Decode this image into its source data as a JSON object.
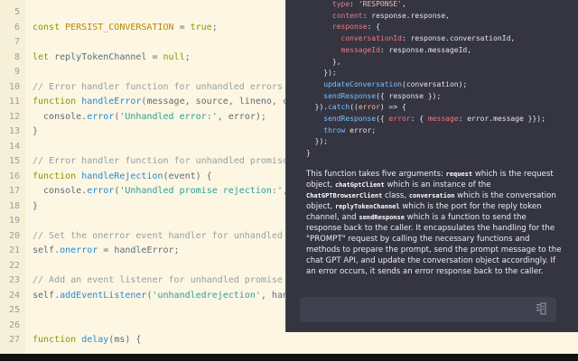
{
  "editor": {
    "lines": [
      {
        "num": "5",
        "tokens": []
      },
      {
        "num": "6",
        "tokens": [
          [
            "kw",
            "const "
          ],
          [
            "con",
            "PERSIST_CONVERSATION"
          ],
          [
            "",
            " = "
          ],
          [
            "kw",
            "true"
          ],
          [
            "",
            ";"
          ]
        ]
      },
      {
        "num": "7",
        "tokens": []
      },
      {
        "num": "8",
        "tokens": [
          [
            "kw",
            "let "
          ],
          [
            "",
            "replyTokenChannel = "
          ],
          [
            "kw",
            "null"
          ],
          [
            "",
            ";"
          ]
        ]
      },
      {
        "num": "9",
        "tokens": []
      },
      {
        "num": "10",
        "tokens": [
          [
            "cm",
            "// Error handler function for unhandled errors"
          ]
        ]
      },
      {
        "num": "11",
        "tokens": [
          [
            "kw",
            "function "
          ],
          [
            "fn",
            "handleError"
          ],
          [
            "",
            "(message, source, lineno, col"
          ]
        ]
      },
      {
        "num": "12",
        "tokens": [
          [
            "",
            "  console."
          ],
          [
            "fn",
            "error"
          ],
          [
            "",
            "("
          ],
          [
            "str",
            "'Unhandled error:'"
          ],
          [
            "",
            ", error);"
          ]
        ]
      },
      {
        "num": "13",
        "tokens": [
          [
            "",
            "}"
          ]
        ]
      },
      {
        "num": "14",
        "tokens": []
      },
      {
        "num": "15",
        "tokens": [
          [
            "cm",
            "// Error handler function for unhandled promise r"
          ]
        ]
      },
      {
        "num": "16",
        "tokens": [
          [
            "kw",
            "function "
          ],
          [
            "fn",
            "handleRejection"
          ],
          [
            "",
            "(event) {"
          ]
        ]
      },
      {
        "num": "17",
        "tokens": [
          [
            "",
            "  console."
          ],
          [
            "fn",
            "error"
          ],
          [
            "",
            "("
          ],
          [
            "str",
            "'Unhandled promise rejection:'"
          ],
          [
            "",
            ", e"
          ]
        ]
      },
      {
        "num": "18",
        "tokens": [
          [
            "",
            "}"
          ]
        ]
      },
      {
        "num": "19",
        "tokens": []
      },
      {
        "num": "20",
        "tokens": [
          [
            "cm",
            "// Set the onerror event handler for unhandled er"
          ]
        ]
      },
      {
        "num": "21",
        "tokens": [
          [
            "",
            "self."
          ],
          [
            "fn",
            "onerror"
          ],
          [
            "",
            " = handleError;"
          ]
        ]
      },
      {
        "num": "22",
        "tokens": []
      },
      {
        "num": "23",
        "tokens": [
          [
            "cm",
            "// Add an event listener for unhandled promise re"
          ]
        ]
      },
      {
        "num": "24",
        "tokens": [
          [
            "",
            "self."
          ],
          [
            "fn",
            "addEventListener"
          ],
          [
            "",
            "("
          ],
          [
            "str",
            "'unhandledrejection'"
          ],
          [
            "",
            ", handl"
          ]
        ]
      },
      {
        "num": "25",
        "tokens": []
      },
      {
        "num": "26",
        "tokens": []
      },
      {
        "num": "27",
        "tokens": [
          [
            "kw",
            "function "
          ],
          [
            "fn",
            "delay"
          ],
          [
            "",
            "(ms) {"
          ]
        ]
      }
    ]
  },
  "panel": {
    "code_lines": [
      {
        "indent": "      ",
        "tokens": [
          [
            "k",
            "type"
          ],
          [
            "",
            ": "
          ],
          [
            "v",
            "'RESPONSE'"
          ],
          [
            "",
            ","
          ]
        ]
      },
      {
        "indent": "      ",
        "tokens": [
          [
            "k",
            "content"
          ],
          [
            "",
            ": response.response,"
          ]
        ]
      },
      {
        "indent": "      ",
        "tokens": [
          [
            "k",
            "response"
          ],
          [
            "",
            ": {"
          ]
        ]
      },
      {
        "indent": "        ",
        "tokens": [
          [
            "k",
            "conversationId"
          ],
          [
            "",
            ": response.conversationId,"
          ]
        ]
      },
      {
        "indent": "        ",
        "tokens": [
          [
            "k",
            "messageId"
          ],
          [
            "",
            ": response.messageId,"
          ]
        ]
      },
      {
        "indent": "      ",
        "tokens": [
          [
            "",
            "},"
          ]
        ]
      },
      {
        "indent": "    ",
        "tokens": [
          [
            "",
            "});"
          ]
        ]
      },
      {
        "indent": "    ",
        "tokens": [
          [
            "f",
            "updateConversation"
          ],
          [
            "",
            "(conversation);"
          ]
        ]
      },
      {
        "indent": "    ",
        "tokens": [
          [
            "f",
            "sendResponse"
          ],
          [
            "",
            "({ response });"
          ]
        ]
      },
      {
        "indent": "  ",
        "tokens": [
          [
            "",
            "})."
          ],
          [
            "f",
            "catch"
          ],
          [
            "",
            "(("
          ],
          [
            "v",
            "error"
          ],
          [
            "",
            ") => {"
          ]
        ]
      },
      {
        "indent": "    ",
        "tokens": [
          [
            "f",
            "sendResponse"
          ],
          [
            "",
            "({ "
          ],
          [
            "k",
            "error"
          ],
          [
            "",
            ": { "
          ],
          [
            "k",
            "message"
          ],
          [
            "",
            ": error.message }});"
          ]
        ]
      },
      {
        "indent": "    ",
        "tokens": [
          [
            "f",
            "throw"
          ],
          [
            "",
            " error;"
          ]
        ]
      },
      {
        "indent": "  ",
        "tokens": [
          [
            "",
            "});"
          ]
        ]
      },
      {
        "indent": "",
        "tokens": [
          [
            "",
            "}"
          ]
        ]
      }
    ],
    "description": [
      {
        "t": "text",
        "v": "This function takes five arguments: "
      },
      {
        "t": "code",
        "v": "request"
      },
      {
        "t": "text",
        "v": " which is the request object, "
      },
      {
        "t": "code",
        "v": "chatGptClient"
      },
      {
        "t": "text",
        "v": " which is an instance of the "
      },
      {
        "t": "code",
        "v": "ChatGPTBrowserClient"
      },
      {
        "t": "text",
        "v": " class, "
      },
      {
        "t": "code",
        "v": "conversation"
      },
      {
        "t": "text",
        "v": " which is the conversation object, "
      },
      {
        "t": "code",
        "v": "replyTokenChannel"
      },
      {
        "t": "text",
        "v": " which is the port for the reply token channel, and "
      },
      {
        "t": "code",
        "v": "sendResponse"
      },
      {
        "t": "text",
        "v": " which is a function to send the response back to the caller. It encapsulates the handling for the \"PROMPT\" request by calling the necessary functions and methods to prepare the prompt, send the prompt message to the chat GPT API, and update the conversation object accordingly. If an error occurs, it sends an error response back to the caller."
      }
    ],
    "input_placeholder": "",
    "send_icon": "send-icon"
  },
  "colors": {
    "editor_bg": "#fdf6e3",
    "panel_bg": "#343541",
    "input_bg": "#40414f"
  }
}
